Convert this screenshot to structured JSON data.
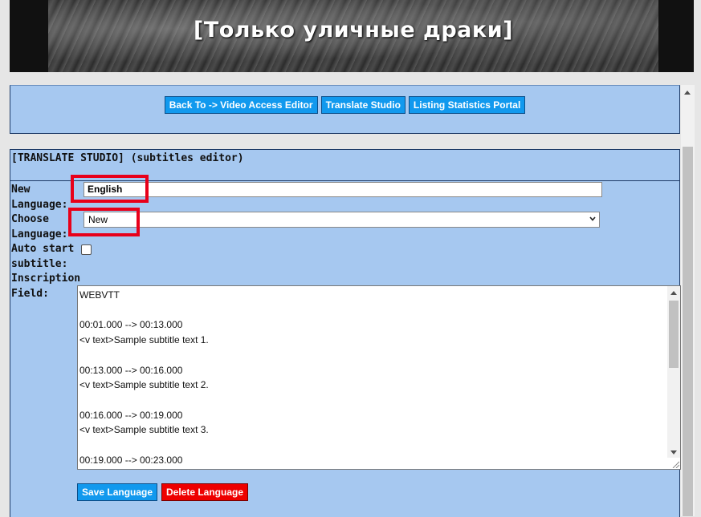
{
  "video": {
    "caption": "[Только уличные драки]"
  },
  "nav": {
    "buttons": [
      {
        "label": "Back To -> Video Access Editor"
      },
      {
        "label": "Translate Studio"
      },
      {
        "label": "Listing Statistics Portal"
      }
    ],
    "button_color": "#1199ee"
  },
  "editor": {
    "title": "[TRANSLATE STUDIO] (subtitles editor)",
    "new_language_label": "New\nLanguage:",
    "new_language_value": "English",
    "choose_language_label": "Choose\nLanguage:",
    "choose_language_selected": "New",
    "autostart_label": "Auto start\nsubtitle:",
    "autostart_checked": false,
    "inscription_label": "Inscription\nField:",
    "inscription_text": "WEBVTT\n\n00:01.000 --> 00:13.000\n<v text>Sample subtitle text 1.\n\n00:13.000 --> 00:16.000\n<v text>Sample subtitle text 2.\n\n00:16.000 --> 00:19.000\n<v text>Sample subtitle text 3.\n\n00:19.000 --> 00:23.000",
    "save_label": "Save Language",
    "delete_label": "Delete Language",
    "save_color": "#1199ee",
    "delete_color": "#ee0000",
    "highlight_color": "#e8001a"
  },
  "icons": {
    "select_chevron": "chevron-down-icon",
    "resize_grip": "resize-grip-icon"
  }
}
